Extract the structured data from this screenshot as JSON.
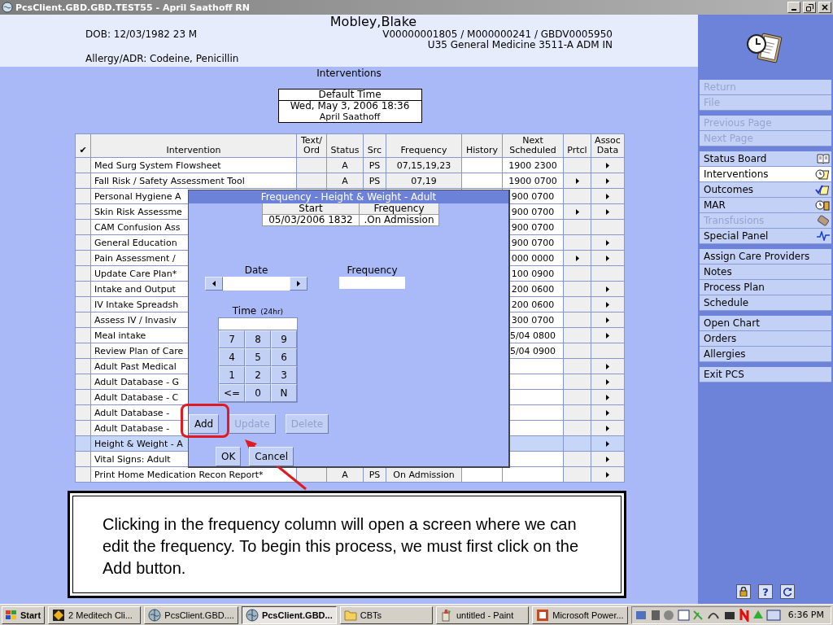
{
  "window": {
    "title": "PcsClient.GBD.GBD.TEST55 - April Saathoff RN"
  },
  "patient": {
    "name": "Mobley,Blake",
    "dob": "DOB: 12/03/1982 23 M",
    "ids": "V00000001805 / M000000241 / GBDV0005950",
    "location": "U35 General Medicine  3511-A  ADM IN",
    "allergy": "Allergy/ADR: Codeine, Penicillin"
  },
  "page_title": "Interventions",
  "default_time": {
    "label": "Default Time",
    "datetime": "Wed, May 3, 2006  18:36",
    "user": "April Saathoff"
  },
  "table": {
    "columns": [
      "✔",
      "Intervention",
      "Text/\nOrd",
      "Status",
      "Src",
      "Frequency",
      "History",
      "Next\nScheduled",
      "Prtcl",
      "Assoc\nData"
    ],
    "rows": [
      {
        "intervention": "Med Surg System Flowsheet",
        "status": "A",
        "src": "PS",
        "frequency": "07,15,19,23",
        "next": "1900 2300",
        "protocol": false,
        "assoc": true,
        "selected": false
      },
      {
        "intervention": "Fall Risk / Safety Assessment Tool",
        "status": "A",
        "src": "PS",
        "frequency": "07,19",
        "next": "1900 0700",
        "protocol": true,
        "assoc": true,
        "selected": false
      },
      {
        "intervention": "Personal Hygiene A",
        "next": "900 0700",
        "protocol": false,
        "assoc": true,
        "selected": false
      },
      {
        "intervention": "Skin Risk Assessme",
        "next": "900 0700",
        "protocol": true,
        "assoc": true,
        "selected": false
      },
      {
        "intervention": "CAM Confusion Ass",
        "next": "900 0700",
        "protocol": false,
        "assoc": false,
        "selected": false
      },
      {
        "intervention": "General Education",
        "next": "900 0700",
        "protocol": false,
        "assoc": true,
        "selected": false
      },
      {
        "intervention": "Pain Assessment /",
        "next": "000 0000",
        "protocol": true,
        "assoc": true,
        "selected": false
      },
      {
        "intervention": "Update Care Plan*",
        "next": "100 0900",
        "protocol": false,
        "assoc": false,
        "selected": false
      },
      {
        "intervention": "Intake and Output",
        "next": "200 0600",
        "protocol": false,
        "assoc": true,
        "selected": false
      },
      {
        "intervention": "IV Intake Spreadsh",
        "next": "200 0600",
        "protocol": false,
        "assoc": true,
        "selected": false
      },
      {
        "intervention": "Assess IV / Invasiv",
        "next": "300 0700",
        "protocol": false,
        "assoc": true,
        "selected": false
      },
      {
        "intervention": "Meal intake",
        "next": "5/04 0800",
        "protocol": false,
        "assoc": true,
        "selected": false
      },
      {
        "intervention": "Review Plan of Care",
        "next": "5/04 0900",
        "protocol": false,
        "assoc": false,
        "selected": false
      },
      {
        "intervention": "Adult Past Medical",
        "protocol": false,
        "assoc": true,
        "selected": false
      },
      {
        "intervention": "Adult Database - G",
        "protocol": false,
        "assoc": true,
        "selected": false
      },
      {
        "intervention": "Adult Database - C",
        "protocol": false,
        "assoc": true,
        "selected": false
      },
      {
        "intervention": "Adult Database -",
        "protocol": false,
        "assoc": true,
        "selected": false
      },
      {
        "intervention": "Adult Database -",
        "protocol": false,
        "assoc": true,
        "selected": false
      },
      {
        "intervention": "Height & Weight - A",
        "protocol": false,
        "assoc": true,
        "selected": true
      },
      {
        "intervention": "Vital Signs: Adult",
        "protocol": false,
        "assoc": true,
        "selected": false
      },
      {
        "intervention": "Print Home Medication Recon Report*",
        "status": "A",
        "src": "PS",
        "frequency": "On Admission",
        "protocol": false,
        "assoc": true,
        "selected": false
      }
    ]
  },
  "dialog": {
    "title": "Frequency - Height & Weight - Adult",
    "columns": [
      "Start",
      "Frequency"
    ],
    "row": [
      "05/03/2006 1832",
      ".On Admission"
    ],
    "date_label": "Date",
    "frequency_label": "Frequency",
    "time_label": "Time",
    "time_hint": "(24hr)",
    "keys": [
      "7",
      "8",
      "9",
      "4",
      "5",
      "6",
      "1",
      "2",
      "3",
      "<=",
      "0",
      "N"
    ],
    "buttons": [
      {
        "label": "Add",
        "disabled": false
      },
      {
        "label": "Update",
        "disabled": true
      },
      {
        "label": "Delete",
        "disabled": true
      }
    ],
    "footer_buttons": [
      "OK",
      "Cancel"
    ]
  },
  "callout": {
    "text": "Clicking in the frequency column will open a screen where we can edit the frequency. To begin this process, we must first click on the Add button."
  },
  "sidebar": {
    "groups": [
      [
        {
          "label": "Return",
          "disabled": true,
          "selected": false
        },
        {
          "label": "File",
          "disabled": true,
          "selected": false
        }
      ],
      [
        {
          "label": "Previous Page",
          "disabled": true,
          "selected": false
        },
        {
          "label": "Next Page",
          "disabled": true,
          "selected": false
        }
      ],
      [
        {
          "label": "Status Board",
          "disabled": false,
          "selected": false
        },
        {
          "label": "Interventions",
          "disabled": false,
          "selected": true
        },
        {
          "label": "Outcomes",
          "disabled": false,
          "selected": false
        },
        {
          "label": "MAR",
          "disabled": false,
          "selected": false
        },
        {
          "label": "Transfusions",
          "disabled": true,
          "selected": false
        },
        {
          "label": "Special Panel",
          "disabled": false,
          "selected": false
        }
      ],
      [
        {
          "label": "Assign Care Providers",
          "disabled": false,
          "selected": false
        },
        {
          "label": "Notes",
          "disabled": false,
          "selected": false
        },
        {
          "label": "Process Plan",
          "disabled": false,
          "selected": false
        },
        {
          "label": "Schedule",
          "disabled": false,
          "selected": false
        }
      ],
      [
        {
          "label": "Open Chart",
          "disabled": false,
          "selected": false
        },
        {
          "label": "Orders",
          "disabled": false,
          "selected": false
        },
        {
          "label": "Allergies",
          "disabled": false,
          "selected": false
        }
      ],
      [
        {
          "label": "Exit PCS",
          "disabled": false,
          "selected": false
        }
      ]
    ],
    "help_label": "?"
  },
  "taskbar": {
    "start": "Start",
    "items": [
      {
        "label": "2 Meditech Cli...",
        "selected": false
      },
      {
        "label": "PcsClient.GBD....",
        "selected": false
      },
      {
        "label": "PcsClient.GBD...",
        "selected": true
      },
      {
        "label": "CBTs",
        "selected": false
      },
      {
        "label": "untitled - Paint",
        "selected": false
      },
      {
        "label": "Microsoft Power...",
        "selected": false
      }
    ],
    "clock": "6:36 PM"
  }
}
